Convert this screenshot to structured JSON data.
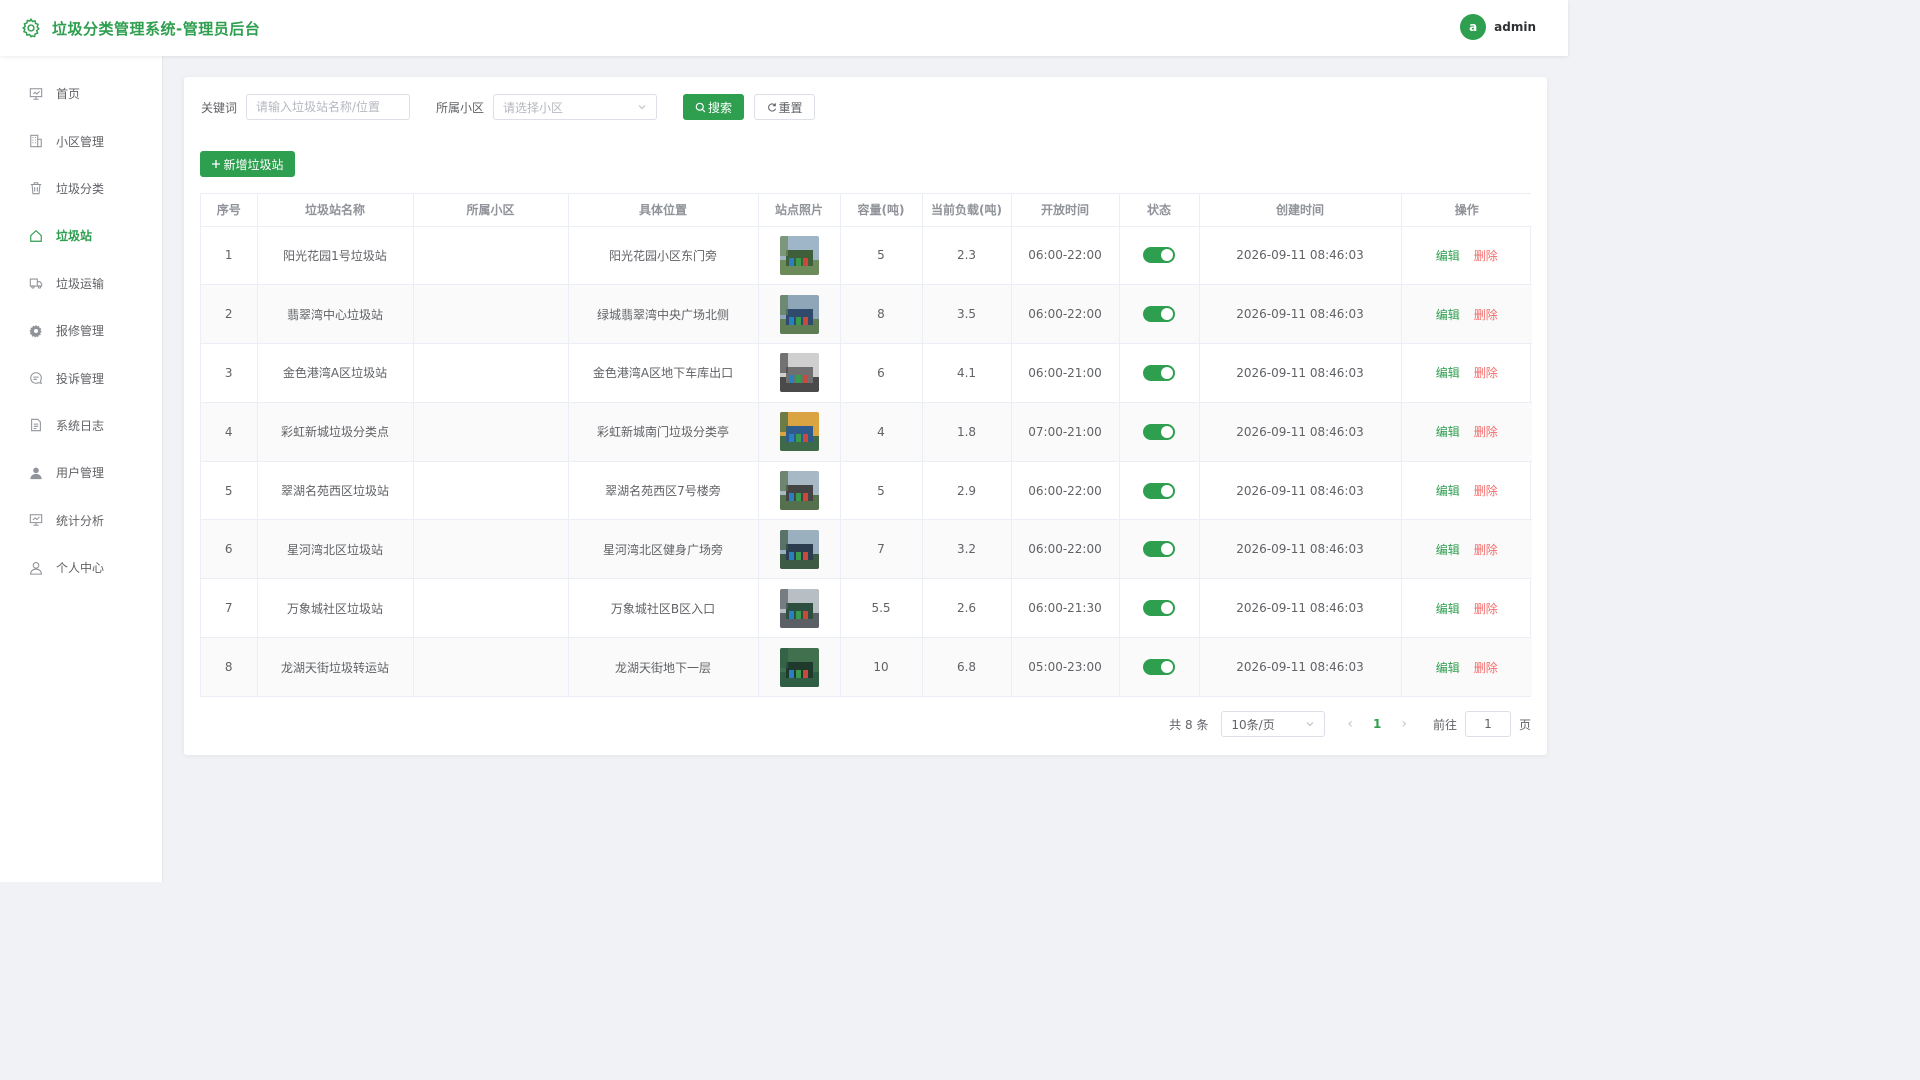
{
  "header": {
    "title": "垃圾分类管理系统-管理员后台",
    "user_initial": "a",
    "username": "admin"
  },
  "sidebar": {
    "items": [
      {
        "label": "首页",
        "icon": "dashboard-icon"
      },
      {
        "label": "小区管理",
        "icon": "building-icon"
      },
      {
        "label": "垃圾分类",
        "icon": "trash-icon"
      },
      {
        "label": "垃圾站",
        "icon": "home-icon",
        "active": true
      },
      {
        "label": "垃圾运输",
        "icon": "truck-icon"
      },
      {
        "label": "报修管理",
        "icon": "gear-icon"
      },
      {
        "label": "投诉管理",
        "icon": "chat-icon"
      },
      {
        "label": "系统日志",
        "icon": "document-icon"
      },
      {
        "label": "用户管理",
        "icon": "user-filled-icon"
      },
      {
        "label": "统计分析",
        "icon": "chart-icon"
      },
      {
        "label": "个人中心",
        "icon": "user-icon"
      }
    ]
  },
  "filter": {
    "keyword_label": "关键词",
    "keyword_placeholder": "请输入垃圾站名称/位置",
    "community_label": "所属小区",
    "community_placeholder": "请选择小区",
    "search_label": "搜索",
    "reset_label": "重置"
  },
  "add_button": "新增垃圾站",
  "table": {
    "columns": [
      "序号",
      "垃圾站名称",
      "所属小区",
      "具体位置",
      "站点照片",
      "容量(吨)",
      "当前负载(吨)",
      "开放时间",
      "状态",
      "创建时间",
      "操作"
    ],
    "rows": [
      {
        "no": "1",
        "name": "阳光花园1号垃圾站",
        "community": "",
        "location": "阳光花园小区东门旁",
        "capacity": "5",
        "load": "2.3",
        "hours": "06:00-22:00",
        "enabled": true,
        "created": "2026-09-11 08:46:03"
      },
      {
        "no": "2",
        "name": "翡翠湾中心垃圾站",
        "community": "",
        "location": "绿城翡翠湾中央广场北侧",
        "capacity": "8",
        "load": "3.5",
        "hours": "06:00-22:00",
        "enabled": true,
        "created": "2026-09-11 08:46:03"
      },
      {
        "no": "3",
        "name": "金色港湾A区垃圾站",
        "community": "",
        "location": "金色港湾A区地下车库出口",
        "capacity": "6",
        "load": "4.1",
        "hours": "06:00-21:00",
        "enabled": true,
        "created": "2026-09-11 08:46:03"
      },
      {
        "no": "4",
        "name": "彩虹新城垃圾分类点",
        "community": "",
        "location": "彩虹新城南门垃圾分类亭",
        "capacity": "4",
        "load": "1.8",
        "hours": "07:00-21:00",
        "enabled": true,
        "created": "2026-09-11 08:46:03"
      },
      {
        "no": "5",
        "name": "翠湖名苑西区垃圾站",
        "community": "",
        "location": "翠湖名苑西区7号楼旁",
        "capacity": "5",
        "load": "2.9",
        "hours": "06:00-22:00",
        "enabled": true,
        "created": "2026-09-11 08:46:03"
      },
      {
        "no": "6",
        "name": "星河湾北区垃圾站",
        "community": "",
        "location": "星河湾北区健身广场旁",
        "capacity": "7",
        "load": "3.2",
        "hours": "06:00-22:00",
        "enabled": true,
        "created": "2026-09-11 08:46:03"
      },
      {
        "no": "7",
        "name": "万象城社区垃圾站",
        "community": "",
        "location": "万象城社区B区入口",
        "capacity": "5.5",
        "load": "2.6",
        "hours": "06:00-21:30",
        "enabled": true,
        "created": "2026-09-11 08:46:03"
      },
      {
        "no": "8",
        "name": "龙湖天街垃圾转运站",
        "community": "",
        "location": "龙湖天街地下一层",
        "capacity": "10",
        "load": "6.8",
        "hours": "05:00-23:00",
        "enabled": true,
        "created": "2026-09-11 08:46:03"
      }
    ],
    "edit_label": "编辑",
    "delete_label": "删除"
  },
  "pagination": {
    "total_text": "共 8 条",
    "page_size": "10条/页",
    "current_page": "1",
    "goto_label": "前往",
    "goto_value": "1",
    "page_suffix": "页"
  },
  "colors": {
    "primary": "#2e9e4f",
    "danger": "#f56c6c"
  }
}
